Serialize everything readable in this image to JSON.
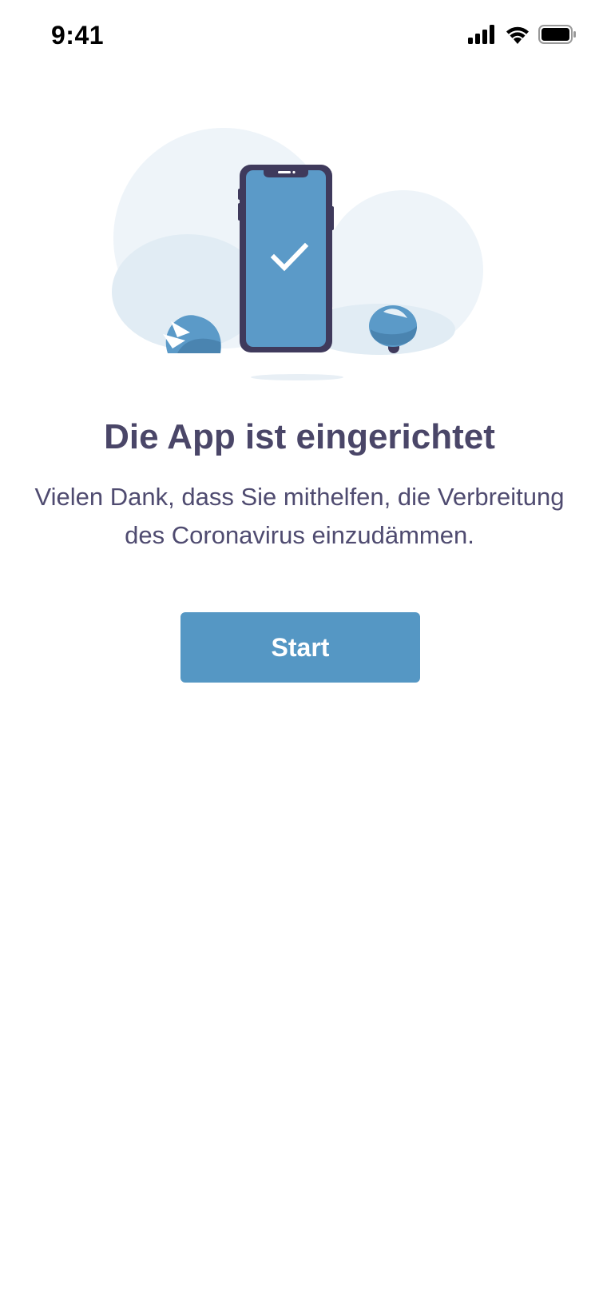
{
  "status_bar": {
    "time": "9:41",
    "icons": [
      "cellular-signal-icon",
      "wifi-icon",
      "battery-icon"
    ]
  },
  "illustration": {
    "description_icons": [
      "phone-icon",
      "checkmark-icon",
      "bush-icon"
    ],
    "colors": {
      "cloud_light": "#eef4f9",
      "cloud_mid": "#e1ecf4",
      "phone_screen": "#5b9ac8",
      "phone_frame": "#3f3a5c",
      "bush": "#5b9ac8",
      "bush_dark": "#4a84b0"
    }
  },
  "content": {
    "title": "Die App ist eingerichtet",
    "subtitle": "Vielen Dank, dass Sie mithelfen, die Verbreitung des Coronavirus einzudämmen."
  },
  "actions": {
    "start_label": "Start"
  },
  "colors": {
    "primary_button": "#5597c4",
    "title_text": "#4a4668",
    "body_text": "#4f4b70",
    "background": "#ffffff"
  }
}
